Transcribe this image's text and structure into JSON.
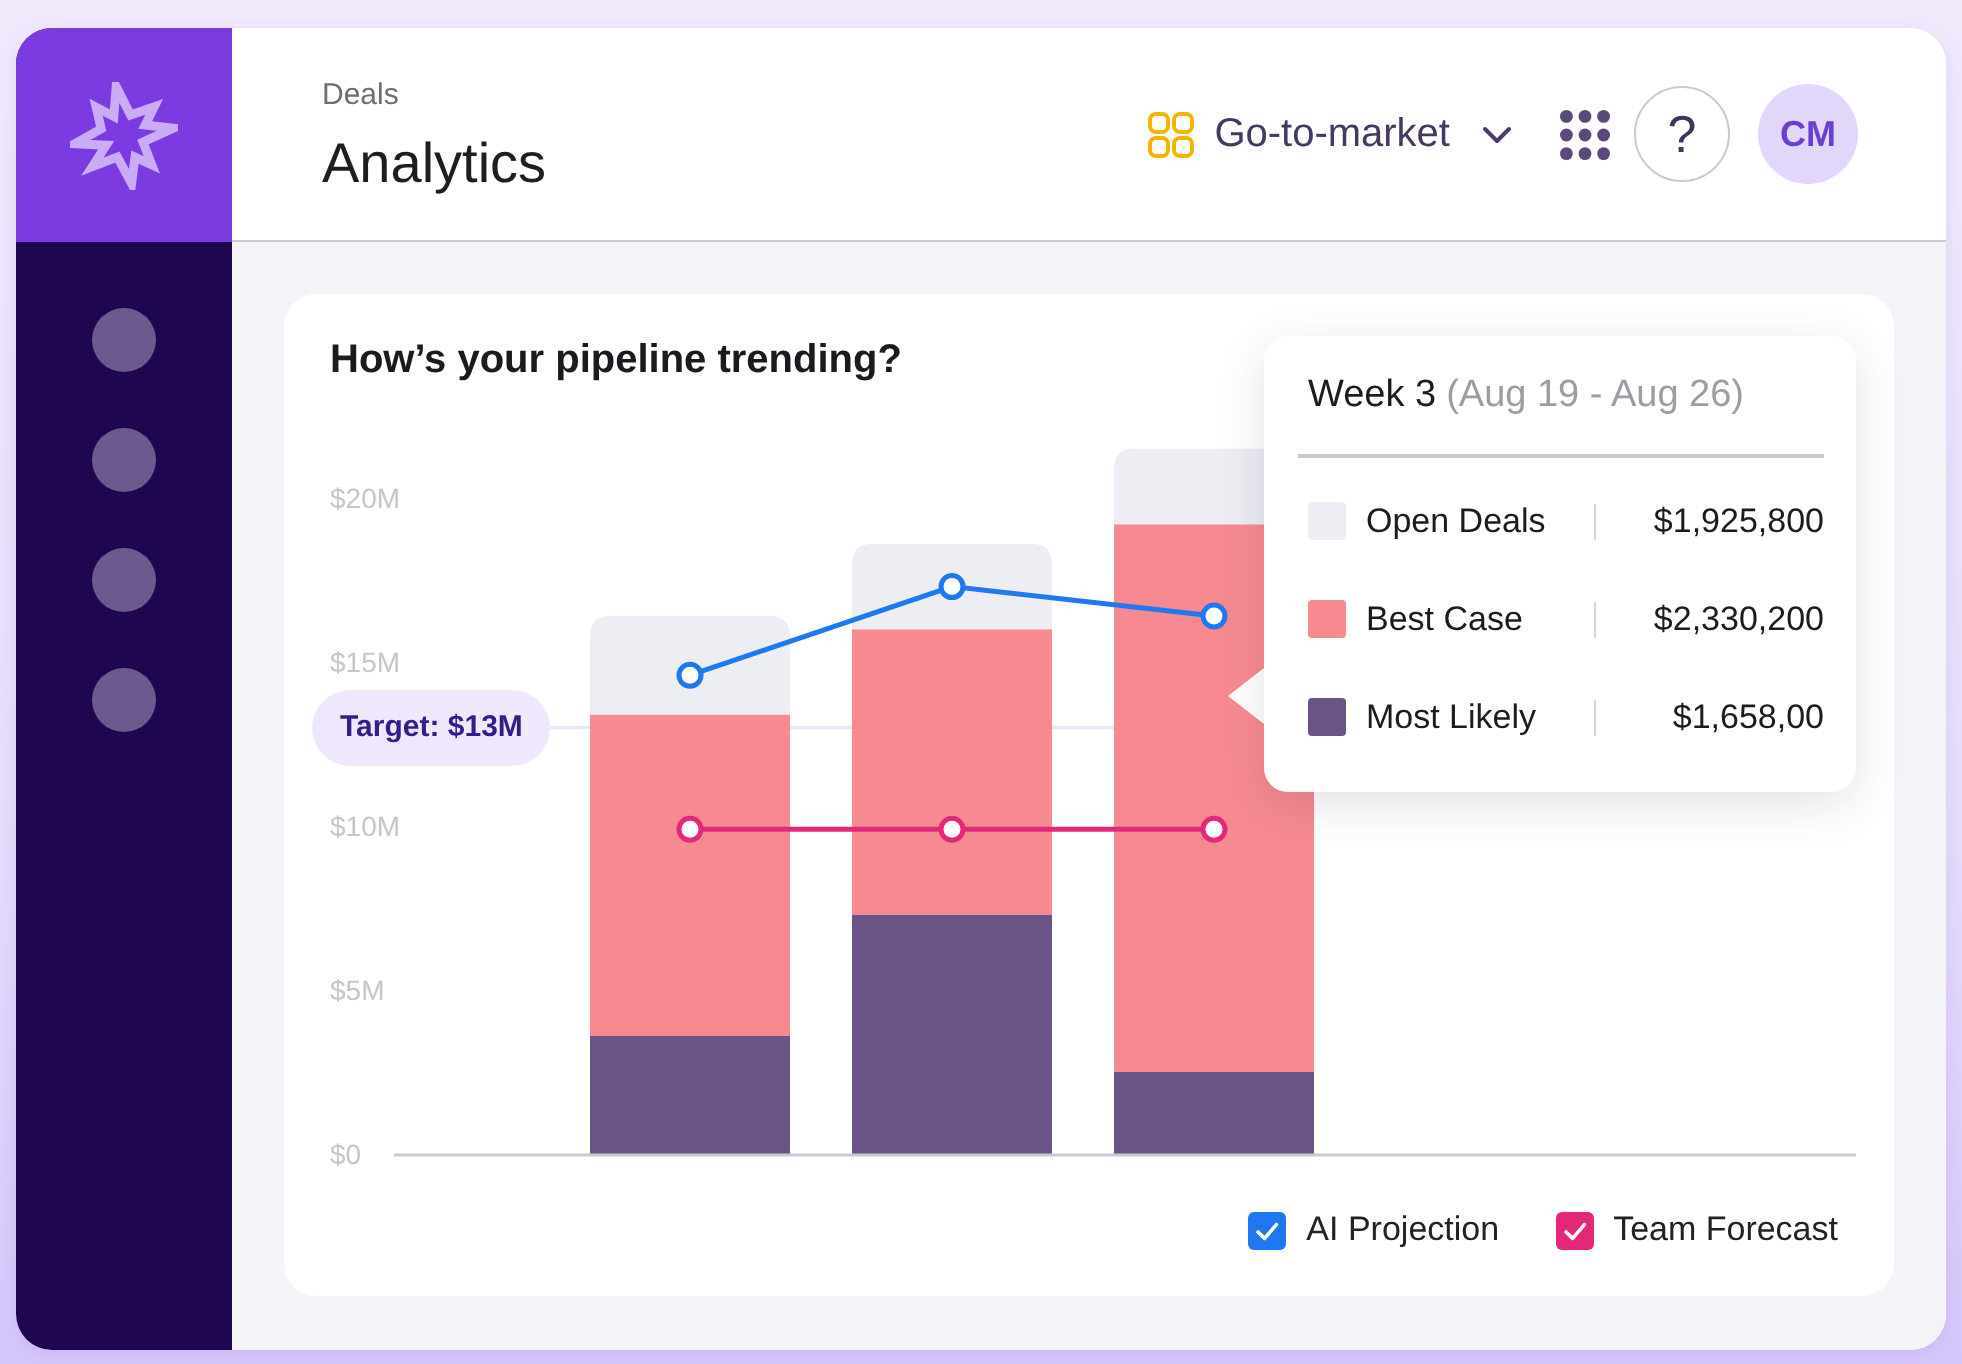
{
  "sidebar": {
    "items": [
      {
        "kind": "dot"
      },
      {
        "kind": "dot"
      },
      {
        "kind": "dot"
      },
      {
        "kind": "dot"
      }
    ]
  },
  "header": {
    "breadcrumb": "Deals",
    "title": "Analytics",
    "workspace": "Go-to-market",
    "help": "?",
    "avatar": "CM"
  },
  "card": {
    "chart_data": {
      "type": "bar",
      "stacked": true,
      "title": "How’s your pipeline trending?",
      "ylim": [
        0,
        21.5
      ],
      "yticks": [
        {
          "value": 0,
          "label": "$0"
        },
        {
          "value": 5,
          "label": "$5M"
        },
        {
          "value": 10,
          "label": "$10M"
        },
        {
          "value": 15,
          "label": "$15M"
        },
        {
          "value": 20,
          "label": "$20M"
        }
      ],
      "series": [
        {
          "name": "Most Likely",
          "color": "#6b5485",
          "values": [
            3.6,
            7.3,
            2.5,
            null,
            null
          ]
        },
        {
          "name": "Best Case",
          "color": "#f78a90",
          "values": [
            9.8,
            8.7,
            16.7,
            null,
            null
          ]
        },
        {
          "name": "Open Deals",
          "color": "#eceef3",
          "values": [
            3.0,
            2.6,
            2.3,
            null,
            null
          ]
        },
        {
          "name": "AI Projection",
          "type": "line",
          "marker": "o",
          "color": "#1f78f0",
          "values": [
            14.6,
            17.3,
            16.4,
            null,
            null
          ]
        },
        {
          "name": "Team Forecast",
          "type": "line",
          "marker": "o",
          "color": "#e3287a",
          "values": [
            9.9,
            9.9,
            9.9,
            null,
            null
          ]
        }
      ],
      "ref_lines": [
        {
          "axis": "y",
          "value": 13,
          "label": "Target: $13M"
        }
      ]
    },
    "legend": [
      {
        "checked": true
      },
      {
        "checked": true
      }
    ],
    "tooltip": {
      "title": "Week 3",
      "dates": "(Aug 19 - Aug 26)",
      "values": [
        "$1,925,800",
        "$2,330,200",
        "$1,658,00"
      ]
    }
  }
}
